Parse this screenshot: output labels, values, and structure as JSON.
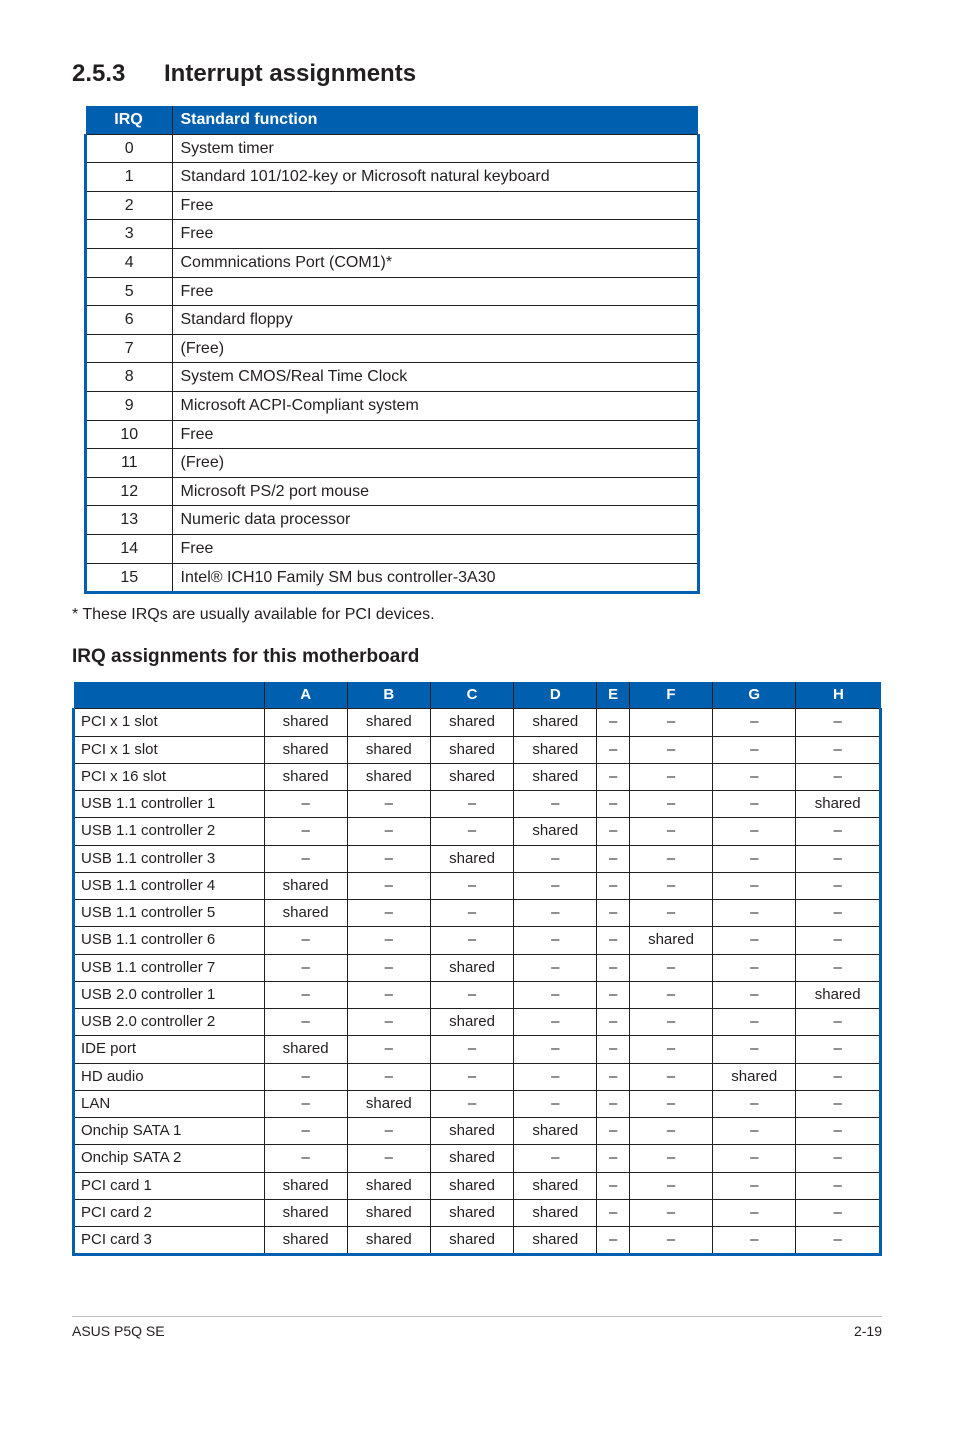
{
  "section": {
    "number": "2.5.3",
    "title": "Interrupt assignments"
  },
  "irqHeader": {
    "irq": "IRQ",
    "func": "Standard function"
  },
  "irqRows": [
    {
      "irq": "0",
      "func": "System timer"
    },
    {
      "irq": "1",
      "func": "Standard 101/102-key or Microsoft natural keyboard"
    },
    {
      "irq": "2",
      "func": "Free"
    },
    {
      "irq": "3",
      "func": "Free"
    },
    {
      "irq": "4",
      "func": "Commnications Port (COM1)*"
    },
    {
      "irq": "5",
      "func": "Free"
    },
    {
      "irq": "6",
      "func": "Standard floppy"
    },
    {
      "irq": "7",
      "func": "(Free)"
    },
    {
      "irq": "8",
      "func": "System CMOS/Real Time Clock"
    },
    {
      "irq": "9",
      "func": "Microsoft ACPI-Compliant system"
    },
    {
      "irq": "10",
      "func": "Free"
    },
    {
      "irq": "11",
      "func": "(Free)"
    },
    {
      "irq": "12",
      "func": "Microsoft PS/2 port mouse"
    },
    {
      "irq": "13",
      "func": "Numeric data processor"
    },
    {
      "irq": "14",
      "func": "Free"
    },
    {
      "irq": "15",
      "func": "Intel® ICH10 Family SM bus controller-3A30"
    }
  ],
  "footnote": "* These IRQs are usually available for PCI devices.",
  "subTitle": "IRQ assignments for this motherboard",
  "assignHeader": {
    "device": "",
    "cols": [
      "A",
      "B",
      "C",
      "D",
      "E",
      "F",
      "G",
      "H"
    ]
  },
  "assignRows": [
    {
      "device": "PCI x 1 slot",
      "vals": [
        "shared",
        "shared",
        "shared",
        "shared",
        "–",
        "–",
        "–",
        "–"
      ]
    },
    {
      "device": "PCI x 1 slot",
      "vals": [
        "shared",
        "shared",
        "shared",
        "shared",
        "–",
        "–",
        "–",
        "–"
      ]
    },
    {
      "device": "PCI x 16 slot",
      "vals": [
        "shared",
        "shared",
        "shared",
        "shared",
        "–",
        "–",
        "–",
        "–"
      ]
    },
    {
      "device": "USB 1.1 controller 1",
      "vals": [
        "–",
        "–",
        "–",
        "–",
        "–",
        "–",
        "–",
        "shared"
      ]
    },
    {
      "device": "USB 1.1 controller 2",
      "vals": [
        "–",
        "–",
        "–",
        "shared",
        "–",
        "–",
        "–",
        "–"
      ]
    },
    {
      "device": "USB 1.1 controller 3",
      "vals": [
        "–",
        "–",
        "shared",
        "–",
        "–",
        "–",
        "–",
        "–"
      ]
    },
    {
      "device": "USB 1.1 controller 4",
      "vals": [
        "shared",
        "–",
        "–",
        "–",
        "–",
        "–",
        "–",
        "–"
      ]
    },
    {
      "device": "USB 1.1 controller 5",
      "vals": [
        "shared",
        "–",
        "–",
        "–",
        "–",
        "–",
        "–",
        "–"
      ]
    },
    {
      "device": "USB 1.1 controller 6",
      "vals": [
        "–",
        "–",
        "–",
        "–",
        "–",
        "shared",
        "–",
        "–"
      ]
    },
    {
      "device": "USB 1.1 controller 7",
      "vals": [
        "–",
        "–",
        "shared",
        "–",
        "–",
        "–",
        "–",
        "–"
      ]
    },
    {
      "device": "USB 2.0 controller 1",
      "vals": [
        "–",
        "–",
        "–",
        "–",
        "–",
        "–",
        "–",
        "shared"
      ]
    },
    {
      "device": "USB 2.0 controller 2",
      "vals": [
        "–",
        "–",
        "shared",
        "–",
        "–",
        "–",
        "–",
        "–"
      ]
    },
    {
      "device": "IDE port",
      "vals": [
        "shared",
        "–",
        "–",
        "–",
        "–",
        "–",
        "–",
        "–"
      ]
    },
    {
      "device": "HD audio",
      "vals": [
        "–",
        "–",
        "–",
        "–",
        "–",
        "–",
        "shared",
        "–"
      ]
    },
    {
      "device": "LAN",
      "vals": [
        "–",
        "shared",
        "–",
        "–",
        "–",
        "–",
        "–",
        "–"
      ]
    },
    {
      "device": "Onchip SATA 1",
      "vals": [
        "–",
        "–",
        "shared",
        "shared",
        "–",
        "–",
        "–",
        "–"
      ]
    },
    {
      "device": "Onchip SATA 2",
      "vals": [
        "–",
        "–",
        "shared",
        "–",
        "–",
        "–",
        "–",
        "–"
      ]
    },
    {
      "device": "PCI card 1",
      "vals": [
        "shared",
        "shared",
        "shared",
        "shared",
        "–",
        "–",
        "–",
        "–"
      ]
    },
    {
      "device": "PCI card 2",
      "vals": [
        "shared",
        "shared",
        "shared",
        "shared",
        "–",
        "–",
        "–",
        "–"
      ]
    },
    {
      "device": "PCI card 3",
      "vals": [
        "shared",
        "shared",
        "shared",
        "shared",
        "–",
        "–",
        "–",
        "–"
      ]
    }
  ],
  "footer": {
    "left": "ASUS P5Q SE",
    "right": "2-19"
  }
}
